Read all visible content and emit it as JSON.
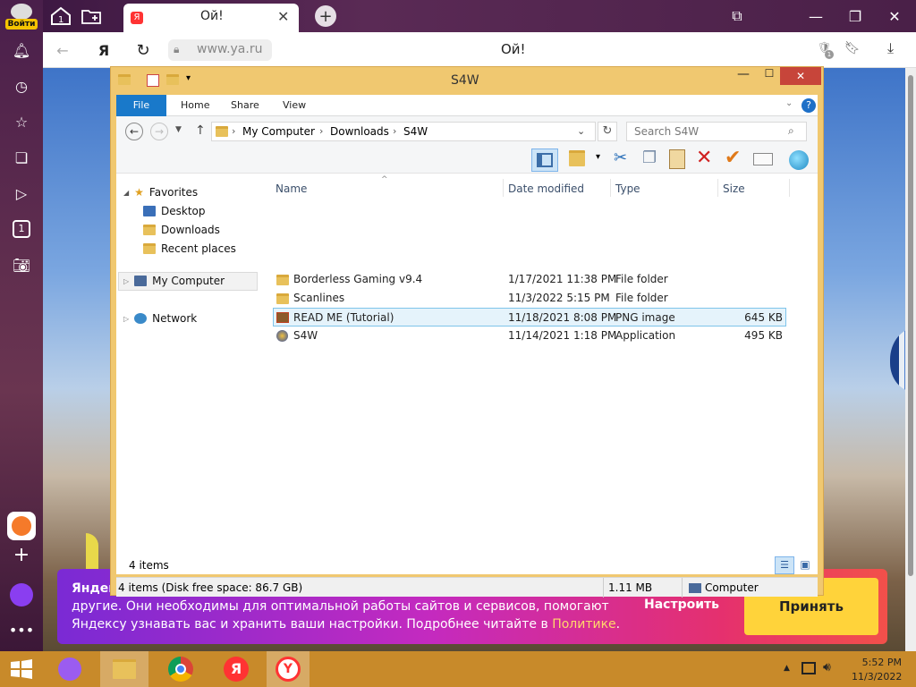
{
  "browser": {
    "login_label": "Войти",
    "tab_title": "Ой!",
    "address": "www.ya.ru",
    "page_title": "Ой!",
    "badge_count": "1",
    "sidebar_badge": "1"
  },
  "cookie": {
    "line1": "Яндек",
    "line2": "другие. Они необходимы для оптимальной работы сайтов и сервисов, помогают",
    "line3": "Яндексу узнавать вас и хранить ваши настройки. Подробнее читайте в",
    "link": "Политике",
    "dot": ".",
    "configure": "Настроить",
    "accept": "Принять"
  },
  "explorer": {
    "title": "S4W",
    "ribbon_tabs": [
      "File",
      "Home",
      "Share",
      "View"
    ],
    "breadcrumb": [
      "My Computer",
      "Downloads",
      "S4W"
    ],
    "search_placeholder": "Search S4W",
    "tree": {
      "favorites": "Favorites",
      "desktop": "Desktop",
      "downloads": "Downloads",
      "recent": "Recent places",
      "my_computer": "My Computer",
      "network": "Network"
    },
    "columns": {
      "name": "Name",
      "date": "Date modified",
      "type": "Type",
      "size": "Size"
    },
    "files": [
      {
        "name": "Borderless Gaming v9.4",
        "date": "1/17/2021 11:38 PM",
        "type": "File folder",
        "size": ""
      },
      {
        "name": "Scanlines",
        "date": "11/3/2022 5:15 PM",
        "type": "File folder",
        "size": ""
      },
      {
        "name": "READ ME (Tutorial)",
        "date": "11/18/2021 8:08 PM",
        "type": "PNG image",
        "size": "645 KB"
      },
      {
        "name": "S4W",
        "date": "11/14/2021 1:18 PM",
        "type": "Application",
        "size": "495 KB"
      }
    ],
    "item_count": "4 items",
    "status_items": "4 items (Disk free space: 86.7 GB)",
    "status_size": "1.11 MB",
    "status_location": "Computer"
  },
  "taskbar": {
    "time": "5:52 PM",
    "date": "11/3/2022"
  }
}
